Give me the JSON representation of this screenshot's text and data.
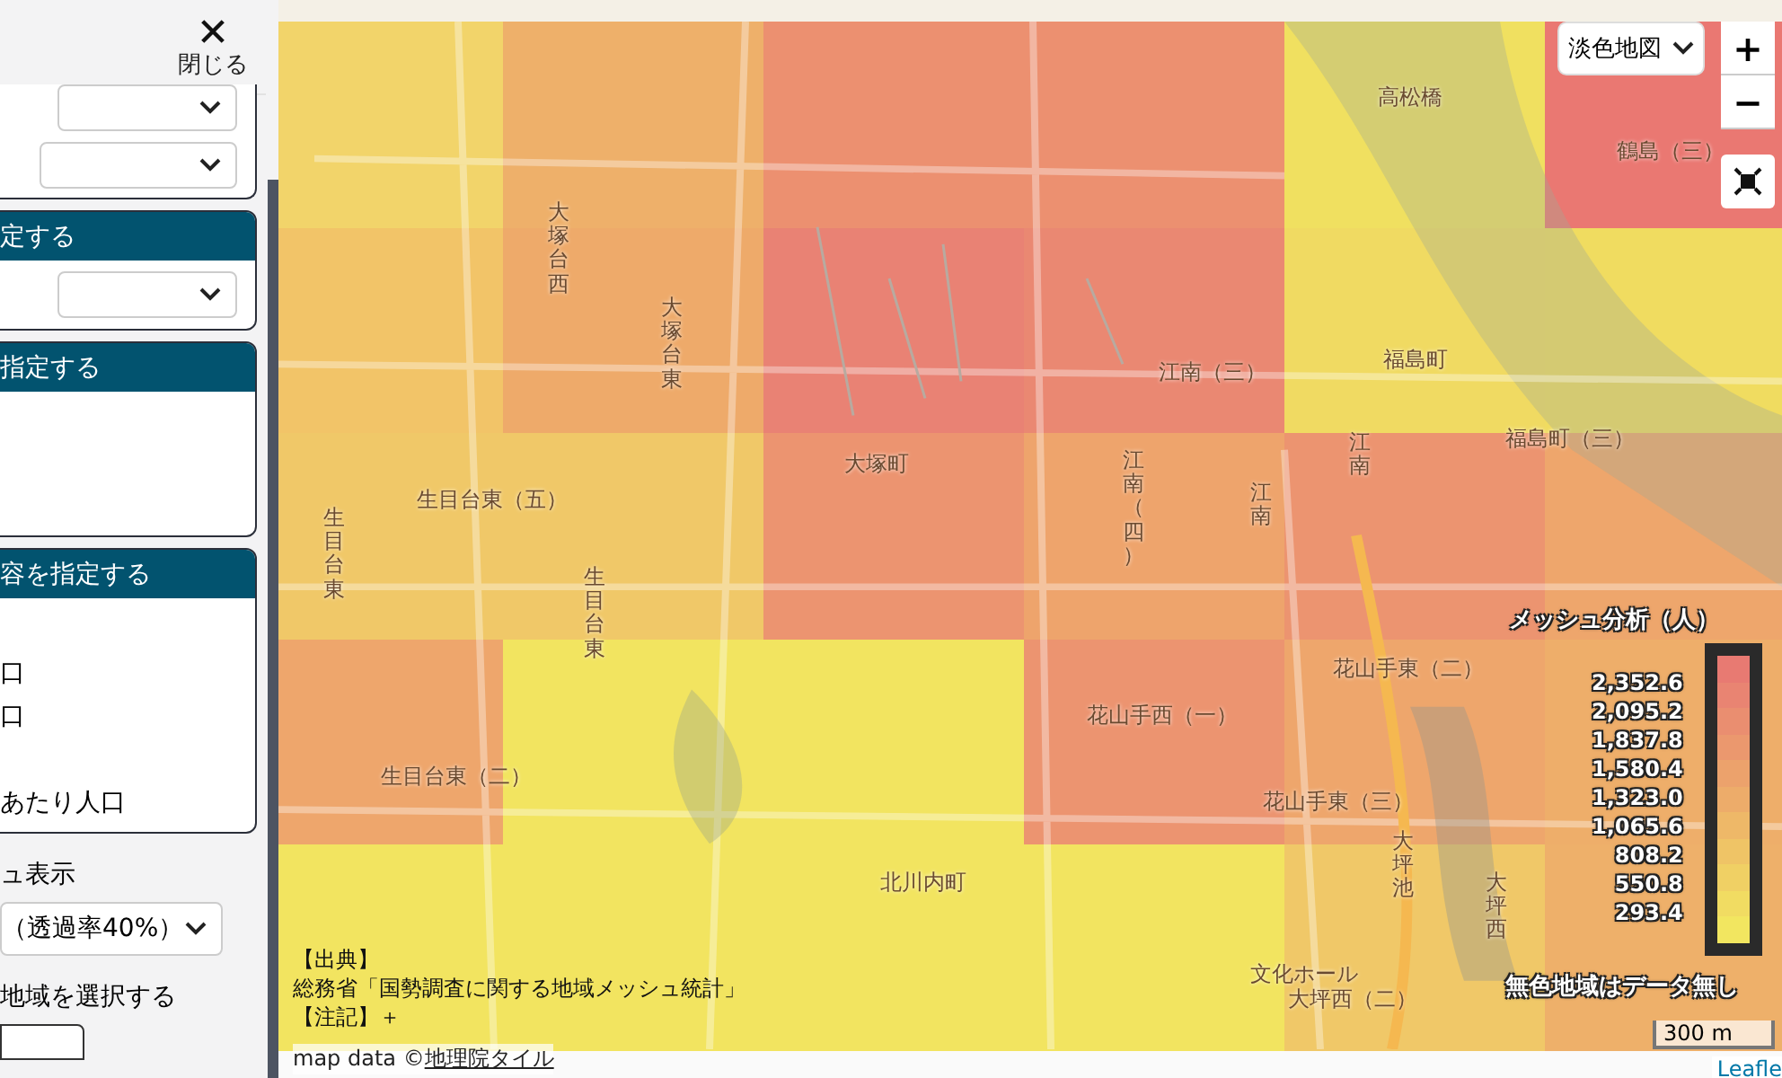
{
  "panel": {
    "close_label": "閉じる",
    "sections": [
      {
        "title": "定する",
        "kind": "select"
      },
      {
        "title": "指定する",
        "kind": "empty"
      },
      {
        "title": "容を指定する",
        "kind": "options",
        "options": [
          "口",
          "口",
          "あたり人口"
        ]
      }
    ],
    "display_label": "ュ表示",
    "display_select": "（透過率40%）",
    "region_label": "地域を選択する"
  },
  "map": {
    "basemap_select": "淡色地図",
    "zoom_in": "+",
    "zoom_out": "−",
    "mesh_rows": [
      {
        "cells": [
          {
            "color": "#f2d46a"
          },
          {
            "color": "#eeb06a"
          },
          {
            "color": "#ec9070"
          },
          {
            "color": "#ec9070"
          },
          {
            "color": "#f0e060"
          },
          {
            "color": "#ea7872"
          }
        ]
      },
      {
        "cells": [
          {
            "color": "#f2c468"
          },
          {
            "color": "#eeaa6a"
          },
          {
            "color": "#e98274"
          },
          {
            "color": "#ea8872"
          },
          {
            "color": "#f0da62"
          },
          {
            "color": "#f0dc60"
          }
        ]
      },
      {
        "cells": [
          {
            "color": "#f0c868"
          },
          {
            "color": "#f0c868"
          },
          {
            "color": "#ec9470"
          },
          {
            "color": "#eea46c"
          },
          {
            "color": "#ec9470"
          },
          {
            "color": "#eea66c"
          }
        ]
      },
      {
        "cells": [
          {
            "color": "#eea66c"
          },
          {
            "color": "#f2e460"
          },
          {
            "color": "#f2e460"
          },
          {
            "color": "#ec9470"
          },
          {
            "color": "#eea66c"
          },
          {
            "color": "#eeae6a"
          }
        ]
      },
      {
        "cells": [
          {
            "color": "#f2e460"
          },
          {
            "color": "#f2e460"
          },
          {
            "color": "#f2e460"
          },
          {
            "color": "#f2e460"
          },
          {
            "color": "#f0c868"
          },
          {
            "color": "#eeb06a"
          }
        ]
      }
    ],
    "labels": [
      "大塚台西",
      "大塚台東",
      "大塚町",
      "生目台東（五）",
      "江南（三）",
      "江南（四）",
      "江南",
      "江南",
      "福島町",
      "福島町（三）",
      "花山手西（一）",
      "花山手東（二）",
      "花山手東（三）",
      "北川内町",
      "文化ホール",
      "生目台東（二）",
      "大坪西（二）",
      "鶴島（三）",
      "高松橋",
      "大坪池",
      "大坪西",
      "生目台東",
      "生目台東"
    ],
    "legend": {
      "title": "メッシュ分析（人）",
      "values": [
        "2,352.6",
        "2,095.2",
        "1,837.8",
        "1,580.4",
        "1,323.0",
        "1,065.6",
        "808.2",
        "550.8",
        "293.4"
      ],
      "steps": [
        {
          "color": "#e87a72"
        },
        {
          "color": "#e98472"
        },
        {
          "color": "#ea8e70"
        },
        {
          "color": "#eb986e"
        },
        {
          "color": "#eca26c"
        },
        {
          "color": "#edac6a"
        },
        {
          "color": "#eeb868"
        },
        {
          "color": "#efc466"
        },
        {
          "color": "#f0d064"
        },
        {
          "color": "#f1dc62"
        },
        {
          "color": "#f2e660"
        }
      ],
      "note": "無色地域はデータ無し"
    },
    "source_heading": "【出典】",
    "source_text": "総務省「国勢調査に関する地域メッシュ統計」",
    "note_heading": "【注記】＋",
    "attribution_prefix": "map data ©",
    "attribution_link": "地理院タイル",
    "scale": "300 m",
    "leaflet": "Leafle"
  }
}
